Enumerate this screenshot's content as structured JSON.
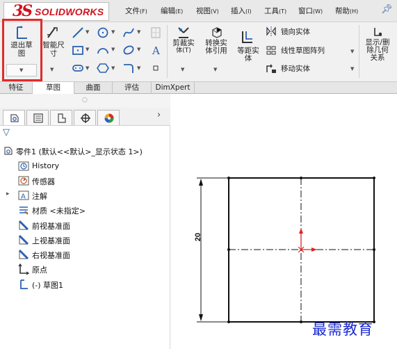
{
  "app": {
    "logo_mark": "3S",
    "logo_text": "SOLIDWORKS"
  },
  "menu": [
    {
      "label": "文件",
      "key": "(F)"
    },
    {
      "label": "编辑",
      "key": "(E)"
    },
    {
      "label": "视图",
      "key": "(V)"
    },
    {
      "label": "插入",
      "key": "(I)"
    },
    {
      "label": "工具",
      "key": "(T)"
    },
    {
      "label": "窗口",
      "key": "(W)"
    },
    {
      "label": "帮助",
      "key": "(H)"
    }
  ],
  "ribbon": {
    "exit_sketch_l1": "退出草",
    "exit_sketch_l2": "图",
    "smart_dim_l1": "智能尺",
    "smart_dim_l2": "寸",
    "trim_l1": "剪裁实",
    "trim_l2": "体",
    "trim_key": "(T)",
    "convert_l1": "转换实",
    "convert_l2": "体引用",
    "offset_l1": "等距实",
    "offset_l2": "体",
    "mirror": "镜向实体",
    "linear_pattern": "线性草图阵列",
    "move": "移动实体",
    "relations_l1": "显示/删",
    "relations_l2": "除几何",
    "relations_l3": "关系"
  },
  "tabs": [
    "特征",
    "草图",
    "曲面",
    "评估",
    "DimXpert"
  ],
  "active_tab": "草图",
  "tree": {
    "root": "零件1  (默认<<默认>_显示状态 1>)",
    "items": [
      {
        "label": "History",
        "icon": "history-icon"
      },
      {
        "label": "传感器",
        "icon": "sensor-icon"
      },
      {
        "label": "注解",
        "icon": "annotation-icon",
        "expandable": true
      },
      {
        "label": "材质 <未指定>",
        "icon": "material-icon"
      },
      {
        "label": "前视基准面",
        "icon": "plane-icon"
      },
      {
        "label": "上视基准面",
        "icon": "plane-icon"
      },
      {
        "label": "右视基准面",
        "icon": "plane-icon"
      },
      {
        "label": "原点",
        "icon": "origin-icon"
      },
      {
        "label": "(-) 草图1",
        "icon": "sketch-icon"
      }
    ]
  },
  "sketch": {
    "dimension": "20"
  },
  "watermark": "最需教育",
  "colors": {
    "accent_red": "#e02b2b",
    "brand_red": "#d0121d",
    "sketch_blue": "#2b4a9a",
    "dim_black": "#111111"
  }
}
